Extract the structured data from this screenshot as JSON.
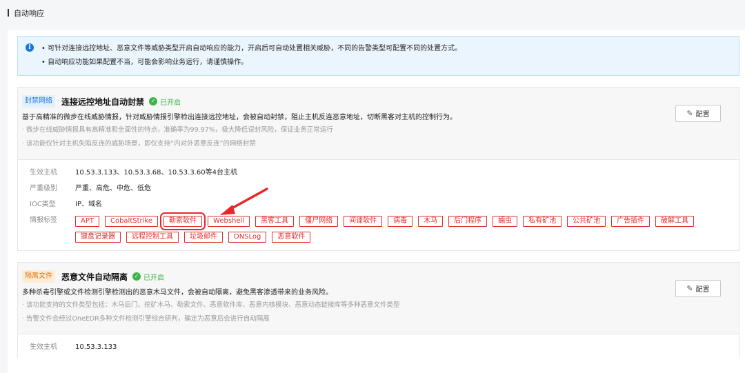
{
  "header": {
    "title": "自动响应"
  },
  "notice": {
    "lines": [
      "• 可针对连接远控地址、恶意文件等威胁类型开启自动响应的能力，开启后可自动处置相关威胁，不同的告警类型可配置不同的处置方式。",
      "• 自动响应功能如果配置不当，可能会影响业务运行，请谨慎操作。"
    ]
  },
  "cards": [
    {
      "badge": "封禁网络",
      "title": "连接远控地址自动封禁",
      "status": "已开启",
      "desc": "基于高精准的微步在线威胁情报，针对威胁情报引擎检出连接远控地址，会被自动封禁，阻止主机反连恶意地址，切断黑客对主机的控制行为。",
      "subs": [
        "· 微步在线威胁情报具有高精准和全面性的特点，准确率为99.97%，极大降低误封风险，保证业务正常运行",
        "· 该功能仅针对主机失陷反连的威胁场景，即仅支持“内对外恶意反连”的网络封禁"
      ],
      "config_label": "配置",
      "rows": {
        "hosts_label": "生效主机",
        "hosts_value": "10.53.3.133、10.53.3.68、10.53.3.60等4台主机",
        "severity_label": "严重级别",
        "severity_value": "严重、高危、中危、低危",
        "ioc_label": "IOC类型",
        "ioc_value": "IP、域名",
        "tags_label": "情报标签"
      },
      "tags": [
        "APT",
        "CobaltStrike",
        "勒索软件",
        "Webshell",
        "黑客工具",
        "僵尸网络",
        "间谍软件",
        "病毒",
        "木马",
        "后门程序",
        "蠕虫",
        "私有矿池",
        "公共矿池",
        "广告插件",
        "破解工具",
        "键盘记录器",
        "远程控制工具",
        "垃圾邮件",
        "DNSLog",
        "恶意软件"
      ]
    },
    {
      "badge": "隔离文件",
      "title": "恶意文件自动隔离",
      "status": "已开启",
      "desc": "多种杀毒引擎或文件检测引擎检测出的恶意木马文件，会被自动隔离，避免黑客渗透带来的业务风险。",
      "subs": [
        "· 该功能支持的文件类型包括：木马后门、挖矿木马、勒索文件、恶意软件库、恶意内核模块、恶意动态链接库等多种恶意文件类型",
        "· 告警文件会经过OneEDR多种文件检测引擎综合研判，确定为恶意后会进行自动隔离"
      ],
      "config_label": "配置",
      "rows": {
        "hosts_label": "生效主机",
        "hosts_value": "10.53.3.133"
      }
    }
  ],
  "colors": {
    "accent": "#1677d9",
    "danger": "#e0302f",
    "success": "#3bb54a",
    "orange": "#e07414"
  },
  "icons": {
    "info": "info-icon",
    "check": "check-icon",
    "edit": "pencil-icon",
    "annotation": "arrow-annotation"
  }
}
